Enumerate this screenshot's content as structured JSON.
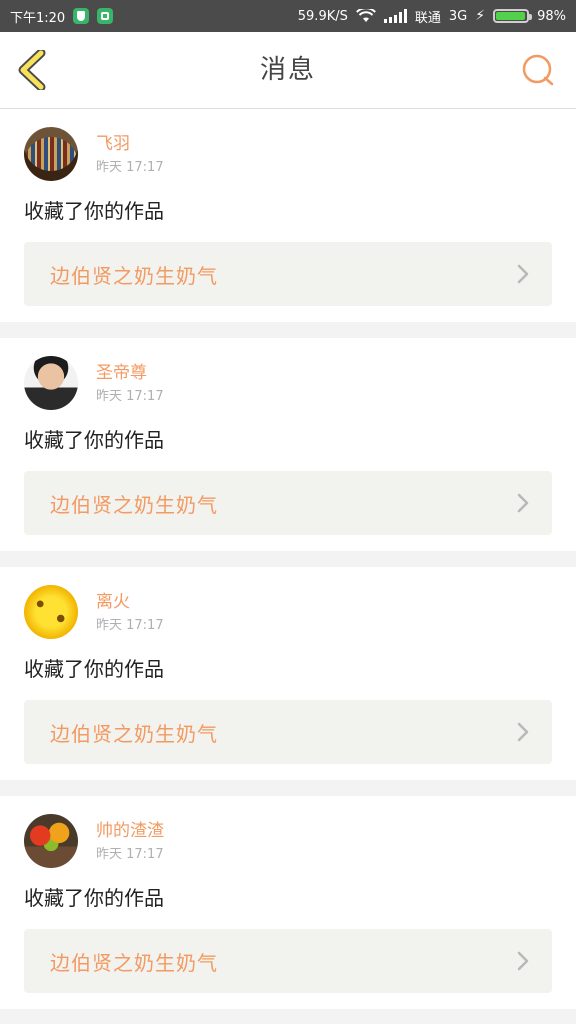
{
  "status_bar": {
    "time": "下午1:20",
    "speed": "59.9K/S",
    "carrier": "联通",
    "network": "3G",
    "battery": "98%",
    "battery_level": 0.98
  },
  "header": {
    "title": "消息"
  },
  "messages": [
    {
      "username": "飞羽",
      "time": "昨天 17:17",
      "action": "收藏了你的作品",
      "work_title": "边伯贤之奶生奶气",
      "avatar": "books"
    },
    {
      "username": "圣帝尊",
      "time": "昨天 17:17",
      "action": "收藏了你的作品",
      "work_title": "边伯贤之奶生奶气",
      "avatar": "person"
    },
    {
      "username": "离火",
      "time": "昨天 17:17",
      "action": "收藏了你的作品",
      "work_title": "边伯贤之奶生奶气",
      "avatar": "sunflower"
    },
    {
      "username": "帅的渣渣",
      "time": "昨天 17:17",
      "action": "收藏了你的作品",
      "work_title": "边伯贤之奶生奶气",
      "avatar": "leaves"
    }
  ],
  "colors": {
    "accent": "#f39a62",
    "back_icon_fill": "#f7e25a",
    "back_icon_stroke": "#4a4a4a"
  }
}
